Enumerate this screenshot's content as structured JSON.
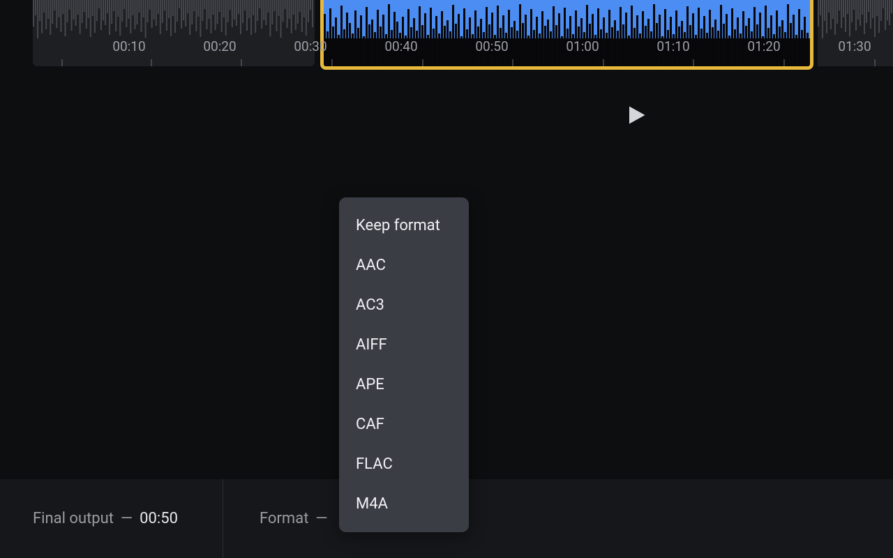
{
  "timeline": {
    "ticks": [
      "00:10",
      "00:20",
      "00:30",
      "00:40",
      "00:50",
      "01:00",
      "01:10",
      "01:20",
      "01:30"
    ]
  },
  "bottom_bar": {
    "final_output_label": "Final output",
    "final_output_time": "00:50",
    "format_label": "Format"
  },
  "format_menu": {
    "items": [
      "Keep format",
      "AAC",
      "AC3",
      "AIFF",
      "APE",
      "CAF",
      "FLAC",
      "M4A"
    ]
  },
  "colors": {
    "selection_border": "#e7b93c",
    "waveform_selected": "#4b8df2"
  }
}
